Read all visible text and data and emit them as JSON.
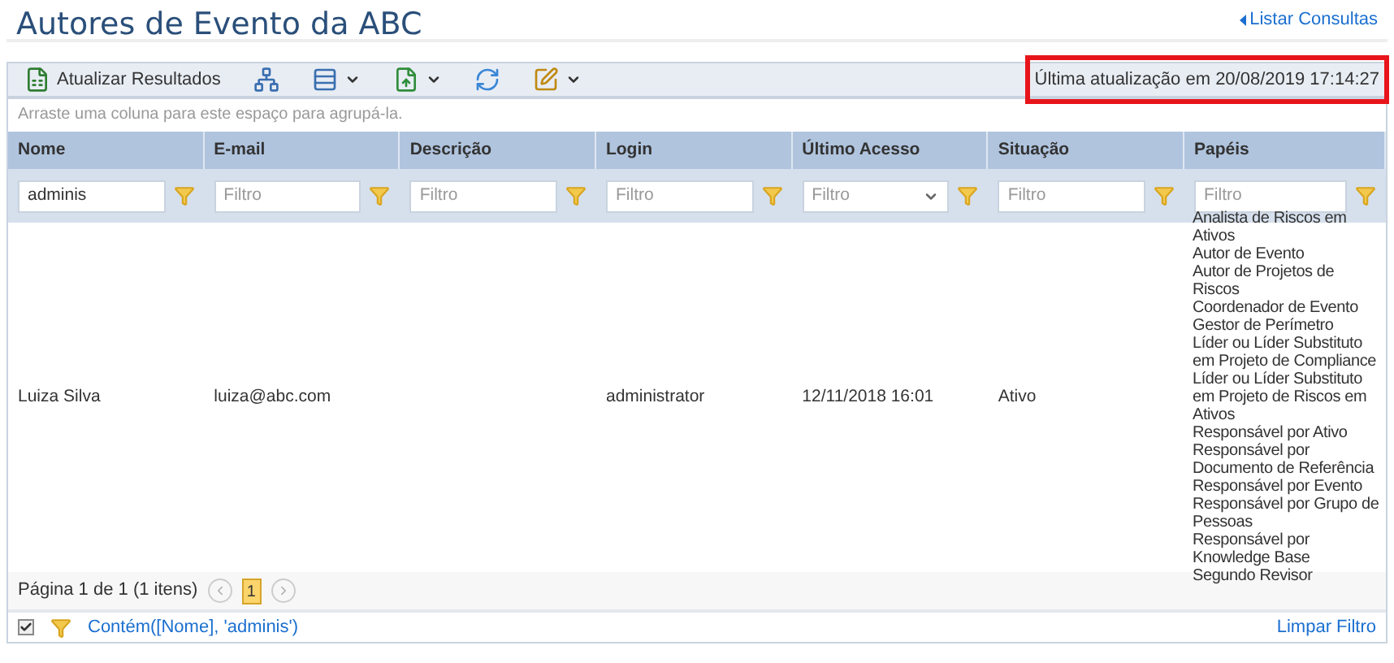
{
  "title": "Autores de Evento da ABC",
  "back_link": "Listar Consultas",
  "toolbar": {
    "buttons": [
      {
        "kind": "refresh_results",
        "label": "Atualizar Resultados",
        "caret": false
      },
      {
        "kind": "tree",
        "caret": false
      },
      {
        "kind": "group",
        "caret": true
      },
      {
        "kind": "export",
        "caret": true
      },
      {
        "kind": "sync",
        "caret": false
      },
      {
        "kind": "edit",
        "caret": true
      }
    ],
    "last_update": {
      "text": "Última atualização em 20/08/2019 17:14:27",
      "highlighted": true
    }
  },
  "group_panel": "Arraste uma coluna para este espaço para agrupá-la.",
  "table": {
    "columns": [
      {
        "label": "Nome",
        "filter": {
          "kind": "text",
          "value": "adminis"
        }
      },
      {
        "label": "E-mail",
        "filter": {
          "kind": "text",
          "placeholder": "Filtro"
        }
      },
      {
        "label": "Descrição",
        "filter": {
          "kind": "text",
          "placeholder": "Filtro"
        }
      },
      {
        "label": "Login",
        "filter": {
          "kind": "text",
          "placeholder": "Filtro"
        }
      },
      {
        "label": "Último Acesso",
        "filter": {
          "kind": "select",
          "placeholder": "Filtro"
        }
      },
      {
        "label": "Situação",
        "filter": {
          "kind": "text",
          "placeholder": "Filtro"
        }
      },
      {
        "label": "Papéis",
        "filter": {
          "kind": "text",
          "placeholder": "Filtro"
        }
      }
    ],
    "rows": [
      {
        "cells": [
          "Luiza Silva",
          "luiza@abc.com",
          "",
          "administrator",
          "12/11/2018 16:01",
          "Ativo"
        ],
        "roles": [
          "Analista de Riscos em Ativos",
          "Autor de Evento",
          "Autor de Projetos de Riscos",
          "Coordenador de Evento",
          "Gestor de Perímetro",
          "Líder ou Líder Substituto em Projeto de Compliance",
          "Líder ou Líder Substituto em Projeto de Riscos em Ativos",
          "Responsável por Ativo",
          "Responsável por Documento de Referência",
          "Responsável por Evento",
          "Responsável por Grupo de Pessoas",
          "Responsável por Knowledge Base",
          "Segundo Revisor"
        ]
      }
    ]
  },
  "pager": {
    "summary": "Página 1 de 1 (1 itens)",
    "pages": [
      {
        "label": "1",
        "selected": true
      }
    ]
  },
  "filter_bar": {
    "enabled": true,
    "expression": "Contém([Nome], 'adminis')",
    "clear": "Limpar Filtro"
  }
}
